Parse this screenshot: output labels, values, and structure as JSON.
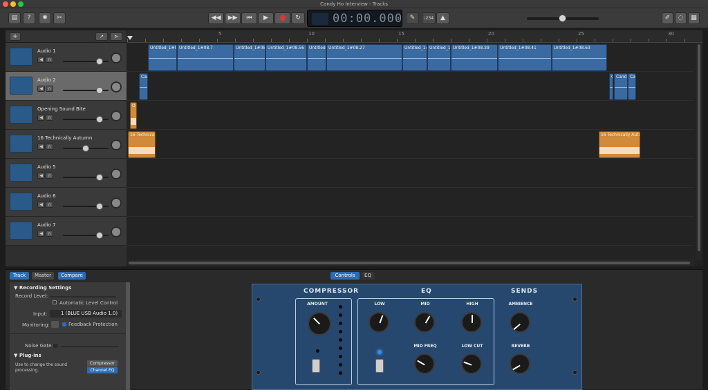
{
  "window": {
    "title": "Candy Ho Interview - Tracks"
  },
  "toolbar": {
    "lcd_time": "00:00.000",
    "tuner_value": "♩234",
    "buttons": [
      "library-icon",
      "help-icon",
      "smart-controls-icon",
      "editors-icon",
      "rewind-icon",
      "forward-icon",
      "go-to-start-icon",
      "play-icon",
      "record-icon",
      "cycle-icon",
      "pencil-icon",
      "metronome-icon",
      "notepad-icon",
      "loops-icon",
      "media-browser-icon"
    ]
  },
  "tracks": {
    "add_label": "+",
    "items": [
      {
        "name": "Audio 1",
        "volume": 0.85,
        "selected": false
      },
      {
        "name": "Audio 2",
        "volume": 0.85,
        "selected": true
      },
      {
        "name": "Opening Sound Bite",
        "volume": 0.85,
        "selected": false
      },
      {
        "name": "16 Technically Autumn",
        "volume": 0.5,
        "selected": false
      },
      {
        "name": "Audio 5",
        "volume": 0.85,
        "selected": false
      },
      {
        "name": "Audio 6",
        "volume": 0.85,
        "selected": false
      },
      {
        "name": "Audio 7",
        "volume": 0.85,
        "selected": false
      }
    ]
  },
  "ruler": {
    "marks": [
      "5",
      "10",
      "15",
      "20",
      "25",
      "30"
    ]
  },
  "regions": {
    "row1": [
      "Untitled_1#08",
      "Untitled_1#08.7",
      "Untitled_1#08",
      "Untitled_1#08.56",
      "Untitled",
      "Untitled_1#08.27",
      "Untitled_1#0",
      "Untitled_1",
      "Untitled_1#08.39",
      "Untitled_1#08.41",
      "Untitled_1#08.63"
    ],
    "row2": [
      "Can",
      "Cand",
      "Ca"
    ],
    "row3": [
      "O"
    ],
    "row4": [
      "16 Technical",
      "16 Technically Autu"
    ]
  },
  "inspector": {
    "tabs": [
      "Track",
      "Master",
      "Compare"
    ],
    "recording_settings": "Recording Settings",
    "record_level": "Record Level:",
    "auto_level": "Automatic Level Control",
    "input_label": "Input:",
    "input_value": "1 (BLUE USB Audio 1.0)",
    "monitoring_label": "Monitoring:",
    "feedback": "Feedback Protection",
    "noise_gate": "Noise Gate:",
    "plugins": "Plug-ins",
    "plugins_hint": "Use to change the sound processing.",
    "plugin_items": [
      "Compressor",
      "Channel EQ"
    ]
  },
  "smart_controls": {
    "tabs": [
      "Controls",
      "EQ"
    ],
    "compressor": {
      "title": "COMPRESSOR",
      "amount": "AMOUNT"
    },
    "eq": {
      "title": "EQ",
      "low": "LOW",
      "mid": "MID",
      "high": "HIGH",
      "mid_freq": "MID FREQ",
      "low_cut": "LOW CUT"
    },
    "sends": {
      "title": "SENDS",
      "ambience": "AMBIENCE",
      "reverb": "REVERB"
    }
  },
  "colors": {
    "region_blue": "#3a6aa0",
    "region_orange": "#d08a3a",
    "record_red": "#e0342e",
    "accent": "#2b6cb5"
  }
}
